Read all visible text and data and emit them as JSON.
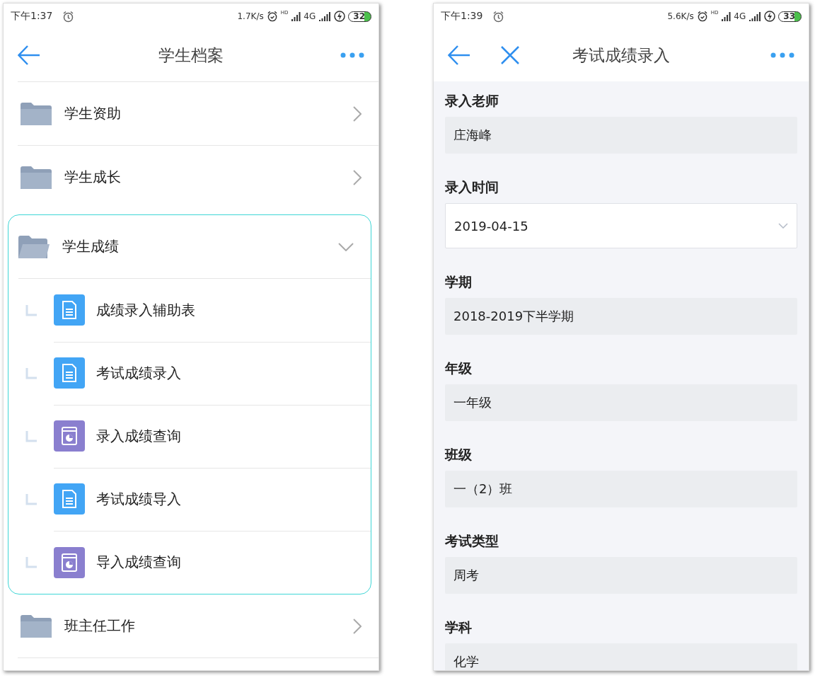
{
  "left_phone": {
    "status_bar": {
      "time": "下午1:37",
      "speed": "1.7K/s",
      "hd": "HD",
      "network": "4G",
      "battery": "32"
    },
    "header": {
      "title": "学生档案"
    },
    "items": [
      {
        "label": "学生资助",
        "expanded": false
      },
      {
        "label": "学生成长",
        "expanded": false
      },
      {
        "label": "学生成绩",
        "expanded": true,
        "children": [
          {
            "label": "成绩录入辅助表",
            "kind": "form"
          },
          {
            "label": "考试成绩录入",
            "kind": "form"
          },
          {
            "label": "录入成绩查询",
            "kind": "report"
          },
          {
            "label": "考试成绩导入",
            "kind": "form"
          },
          {
            "label": "导入成绩查询",
            "kind": "report"
          }
        ]
      },
      {
        "label": "班主任工作",
        "expanded": false
      }
    ]
  },
  "right_phone": {
    "status_bar": {
      "time": "下午1:39",
      "speed": "5.6K/s",
      "hd": "HD",
      "network": "4G",
      "battery": "33"
    },
    "header": {
      "title": "考试成绩录入"
    },
    "fields": [
      {
        "label": "录入老师",
        "kind": "text",
        "value": "庄海峰"
      },
      {
        "label": "录入时间",
        "kind": "select",
        "value": "2019-04-15"
      },
      {
        "label": "学期",
        "kind": "text",
        "value": "2018-2019下半学期"
      },
      {
        "label": "年级",
        "kind": "text",
        "value": "一年级"
      },
      {
        "label": "班级",
        "kind": "text",
        "value": "一（2）班"
      },
      {
        "label": "考试类型",
        "kind": "text",
        "value": "周考"
      },
      {
        "label": "学科",
        "kind": "text",
        "value": "化学"
      }
    ]
  }
}
